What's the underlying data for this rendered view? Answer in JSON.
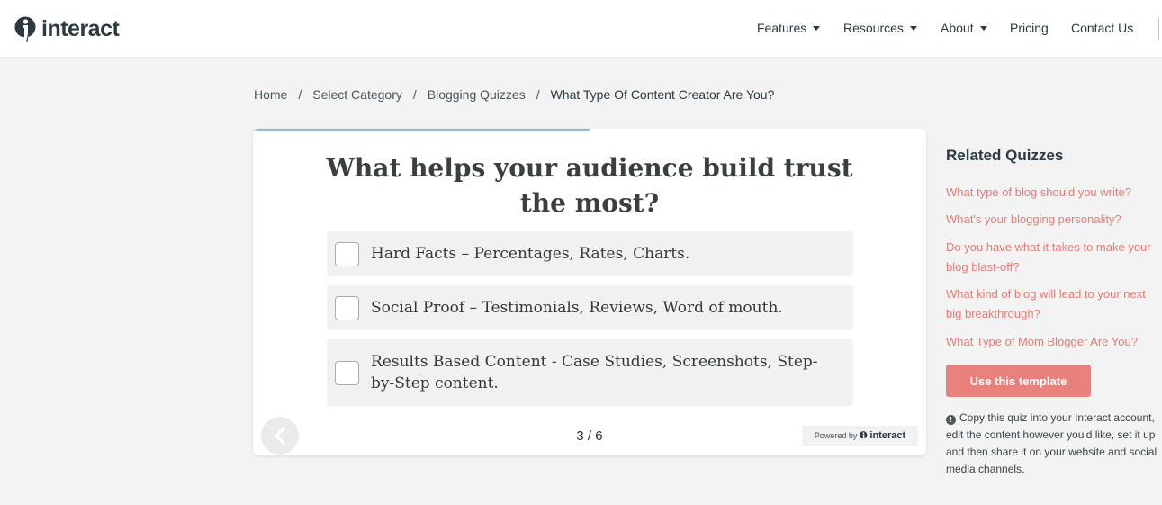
{
  "brand": {
    "name": "interact"
  },
  "nav": {
    "features": "Features",
    "resources": "Resources",
    "about": "About",
    "pricing": "Pricing",
    "contact": "Contact Us"
  },
  "breadcrumb": {
    "home": "Home",
    "category": "Select Category",
    "subcategory": "Blogging Quizzes",
    "current": "What Type Of Content Creator Are You?",
    "separator": "/"
  },
  "quiz": {
    "progress_fraction": 0.5,
    "question": "What helps your audience build trust the most?",
    "options": [
      "Hard Facts – Percentages, Rates, Charts.",
      "Social Proof – Testimonials, Reviews, Word of mouth.",
      "Results Based Content - Case Studies, Screenshots, Step-by-Step content."
    ],
    "page_count": "3 / 6",
    "powered_by_label": "Powered by",
    "powered_by_brand": "interact"
  },
  "sidebar": {
    "title": "Related Quizzes",
    "links": [
      "What type of blog should you write?",
      "What's your blogging personality?",
      "Do you have what it takes to make your blog blast-off?",
      "What kind of blog will lead to your next big breakthrough?",
      "What Type of Mom Blogger Are You?"
    ],
    "template_button": "Use this template",
    "info": "Copy this quiz into your Interact account, edit the content however you'd like, set it up and then share it on your website and social media channels."
  },
  "colors": {
    "accent": "#e8807c",
    "link": "#e07d78",
    "progress": "#8fb8df",
    "background": "#f2f3f2"
  },
  "icons": {
    "logo": "interact-logo-icon",
    "back": "chevron-left-icon",
    "info": "info-icon",
    "dropdown": "caret-down-icon"
  }
}
